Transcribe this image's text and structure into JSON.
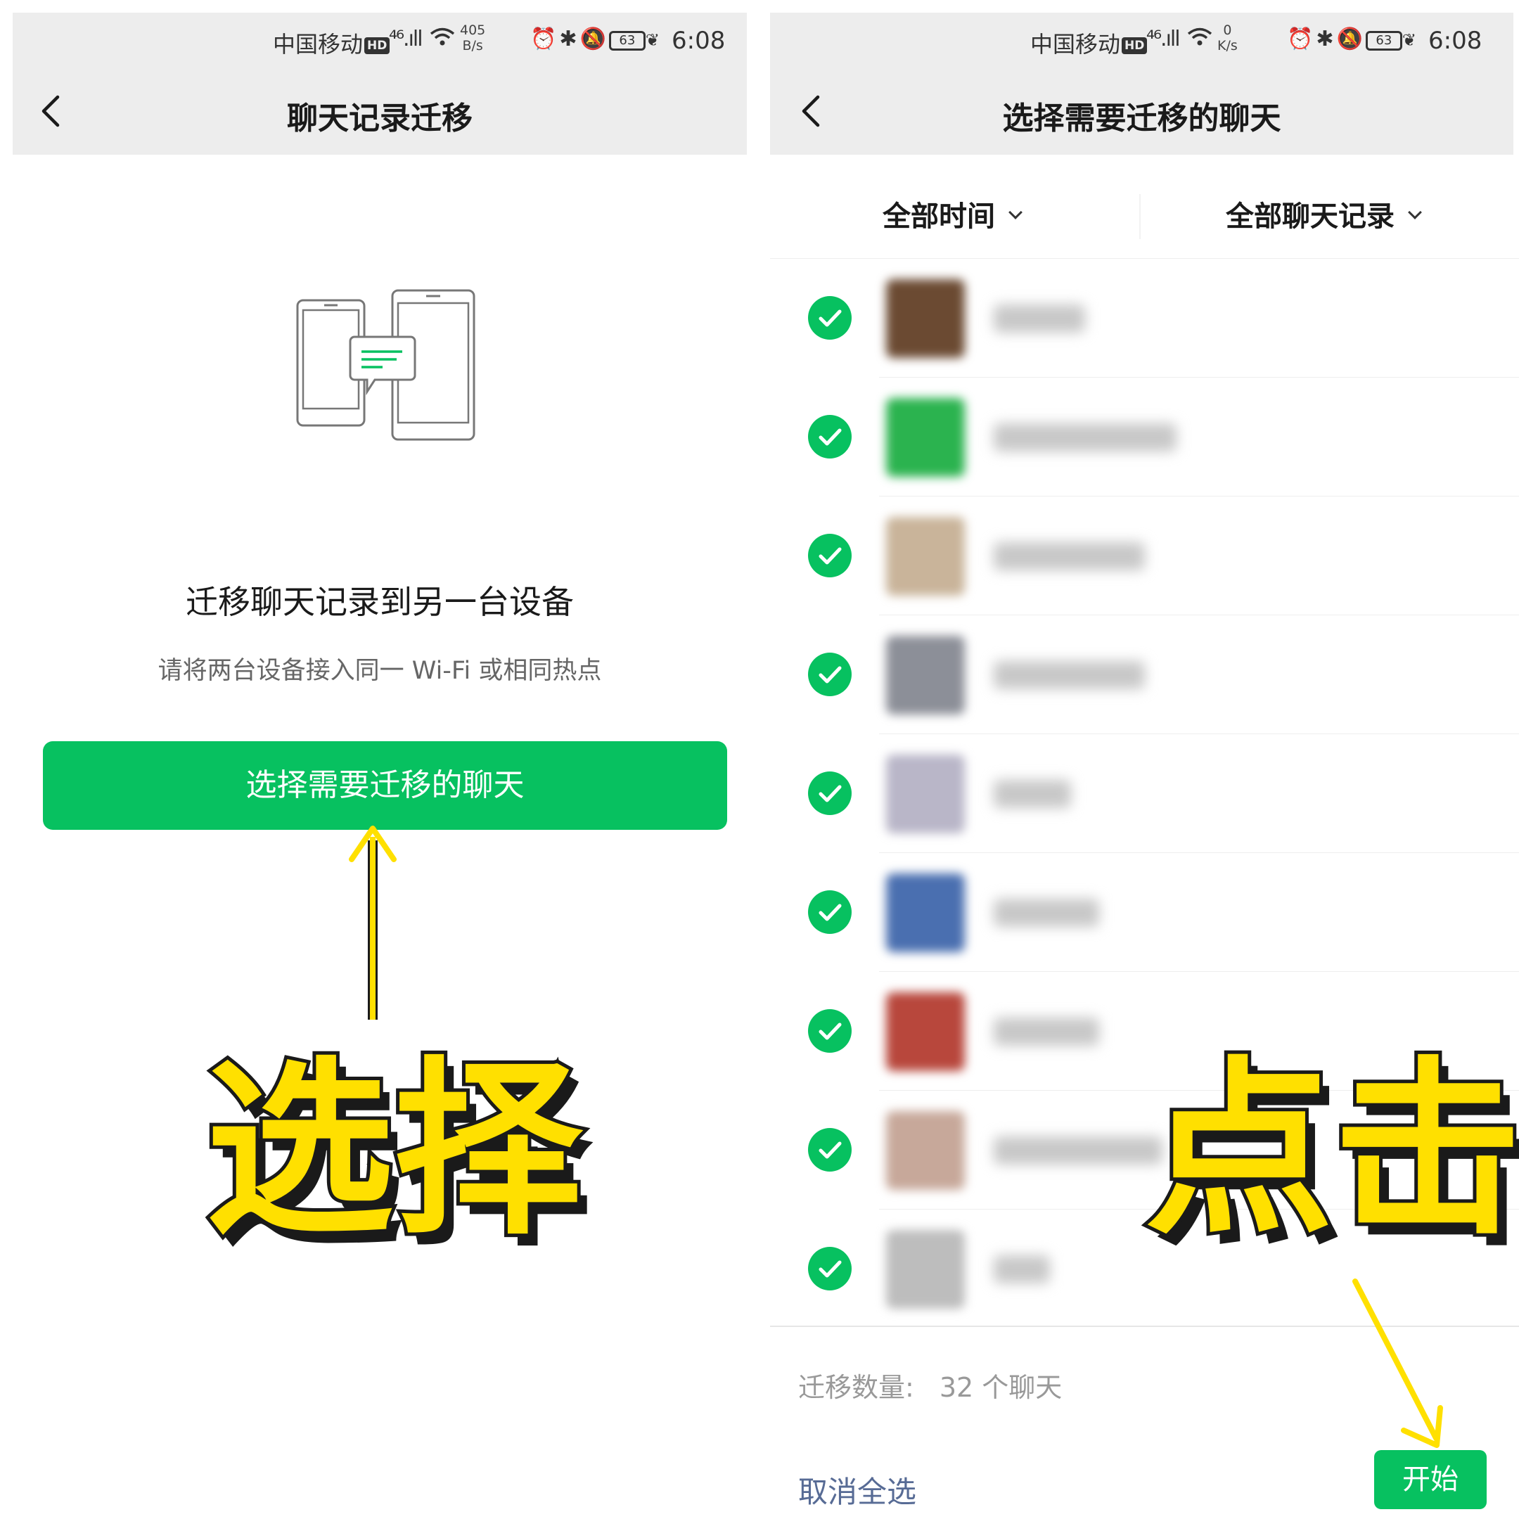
{
  "status_left": {
    "carrier": "中国移动",
    "hd": "HD",
    "net": "⁴⁶.ıll",
    "rate_top": "405",
    "rate_bottom": "B/s",
    "battery": "63",
    "time": "6:08"
  },
  "status_right": {
    "carrier": "中国移动",
    "hd": "HD",
    "net": "⁴⁶.ıll",
    "rate_top": "0",
    "rate_bottom": "K/s",
    "battery": "63",
    "time": "6:08"
  },
  "left": {
    "nav_title": "聊天记录迁移",
    "main_title": "迁移聊天记录到另一台设备",
    "sub_title": "请将两台设备接入同一 Wi-Fi 或相同热点",
    "button": "选择需要迁移的聊天"
  },
  "right": {
    "nav_title": "选择需要迁移的聊天",
    "filter_time": "全部时间",
    "filter_records": "全部聊天记录",
    "chats": [
      {
        "avatar_color": "#6b4a32"
      },
      {
        "avatar_color": "#2bb34f"
      },
      {
        "avatar_color": "#c9b49a"
      },
      {
        "avatar_color": "#8c8f98"
      },
      {
        "avatar_color": "#b9b6c8"
      },
      {
        "avatar_color": "#4a6fb0"
      },
      {
        "avatar_color": "#b8473c"
      },
      {
        "avatar_color": "#c7a89a"
      },
      {
        "avatar_color": "#bdbdbd"
      }
    ],
    "count_label": "迁移数量:",
    "count_value": "32 个聊天",
    "cancel_all": "取消全选",
    "start": "开始"
  },
  "annotations": {
    "left_word": "选择",
    "right_word": "点击"
  },
  "colors": {
    "accent": "#07c160",
    "link": "#576b95",
    "annotation": "#ffe000"
  }
}
